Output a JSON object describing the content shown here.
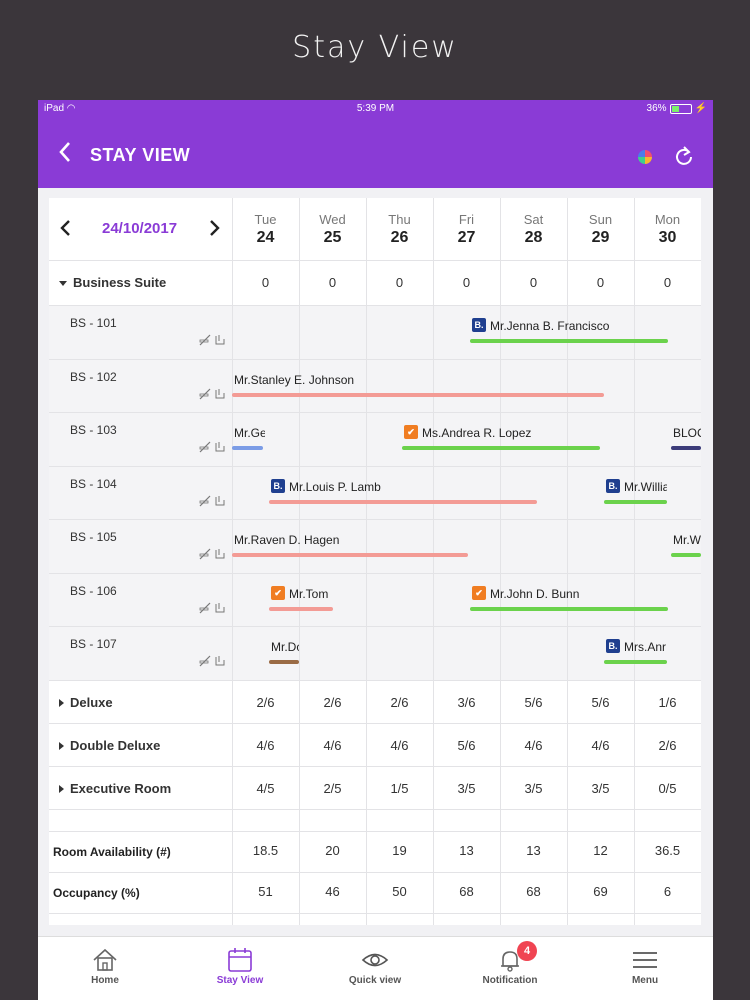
{
  "page_heading": "Stay View",
  "status_bar": {
    "device": "iPad",
    "time": "5:39 PM",
    "battery": "36%"
  },
  "nav": {
    "title": "STAY VIEW"
  },
  "date_picker": {
    "date": "24/10/2017"
  },
  "days": [
    {
      "name": "Tue",
      "num": "24"
    },
    {
      "name": "Wed",
      "num": "25"
    },
    {
      "name": "Thu",
      "num": "26"
    },
    {
      "name": "Fri",
      "num": "27"
    },
    {
      "name": "Sat",
      "num": "28"
    },
    {
      "name": "Sun",
      "num": "29"
    },
    {
      "name": "Mon",
      "num": "30"
    }
  ],
  "business_suite": {
    "label": "Business Suite",
    "counts": [
      "0",
      "0",
      "0",
      "0",
      "0",
      "0",
      "0"
    ],
    "rooms": [
      "BS - 101",
      "BS - 102",
      "BS - 103",
      "BS - 104",
      "BS - 105",
      "BS - 106",
      "BS - 107"
    ]
  },
  "bookings": [
    {
      "room": 0,
      "name": "Mr.Jenna B. Francisco",
      "badge": "B.",
      "badge_type": "b",
      "color": "#6bd24c"
    },
    {
      "room": 1,
      "name": "Mr.Stanley E. Johnson",
      "badge": "",
      "badge_type": "",
      "color": "#f39b95"
    },
    {
      "room": 2,
      "name": "Mr.Ge",
      "badge": "",
      "badge_type": "",
      "color": "#7b9ce6"
    },
    {
      "room": 2,
      "name": "Ms.Andrea R. Lopez",
      "badge": "✔",
      "badge_type": "o",
      "color": "#6bd24c"
    },
    {
      "room": 2,
      "name": "BLOC",
      "badge": "",
      "badge_type": "",
      "color": "#3c3c7a"
    },
    {
      "room": 3,
      "name": "Mr.Louis P. Lamb",
      "badge": "B.",
      "badge_type": "b",
      "color": "#f39b95"
    },
    {
      "room": 3,
      "name": "Mr.Willia",
      "badge": "B.",
      "badge_type": "b",
      "color": "#6bd24c"
    },
    {
      "room": 4,
      "name": "Mr.Raven D. Hagen",
      "badge": "",
      "badge_type": "",
      "color": "#f39b95"
    },
    {
      "room": 4,
      "name": "Mr.Wi",
      "badge": "",
      "badge_type": "",
      "color": "#6bd24c"
    },
    {
      "room": 5,
      "name": "Mr.Tom",
      "badge": "✔",
      "badge_type": "o",
      "color": "#f39b95"
    },
    {
      "room": 5,
      "name": "Mr.John D. Bunn",
      "badge": "✔",
      "badge_type": "o",
      "color": "#6bd24c"
    },
    {
      "room": 6,
      "name": "Mr.Dc",
      "badge": "",
      "badge_type": "",
      "color": "#9a6b45"
    },
    {
      "room": 6,
      "name": "Mrs.Anr",
      "badge": "B.",
      "badge_type": "b",
      "color": "#6bd24c"
    }
  ],
  "room_types": [
    {
      "label": "Deluxe",
      "values": [
        "2/6",
        "2/6",
        "2/6",
        "3/6",
        "5/6",
        "5/6",
        "1/6"
      ]
    },
    {
      "label": "Double Deluxe",
      "values": [
        "4/6",
        "4/6",
        "4/6",
        "5/6",
        "4/6",
        "4/6",
        "2/6"
      ]
    },
    {
      "label": "Executive Room",
      "values": [
        "4/5",
        "2/5",
        "1/5",
        "3/5",
        "3/5",
        "3/5",
        "0/5"
      ]
    }
  ],
  "summary": [
    {
      "label": "Room Availability (#)",
      "values": [
        "18.5",
        "20",
        "19",
        "13",
        "13",
        "12",
        "36.5"
      ]
    },
    {
      "label": "Occupancy (%)",
      "values": [
        "51",
        "46",
        "50",
        "68",
        "68",
        "69",
        "6"
      ]
    }
  ],
  "tabs": [
    {
      "label": "Home",
      "icon": "home-icon"
    },
    {
      "label": "Stay View",
      "icon": "calendar-icon"
    },
    {
      "label": "Quick view",
      "icon": "eye-icon"
    },
    {
      "label": "Notification",
      "icon": "bell-icon",
      "badge": "4"
    },
    {
      "label": "Menu",
      "icon": "menu-icon"
    }
  ],
  "colors": {
    "brand": "#8a3bd6",
    "confirmed": "#6bd24c",
    "pending": "#f39b95",
    "notification": "#f04452"
  }
}
